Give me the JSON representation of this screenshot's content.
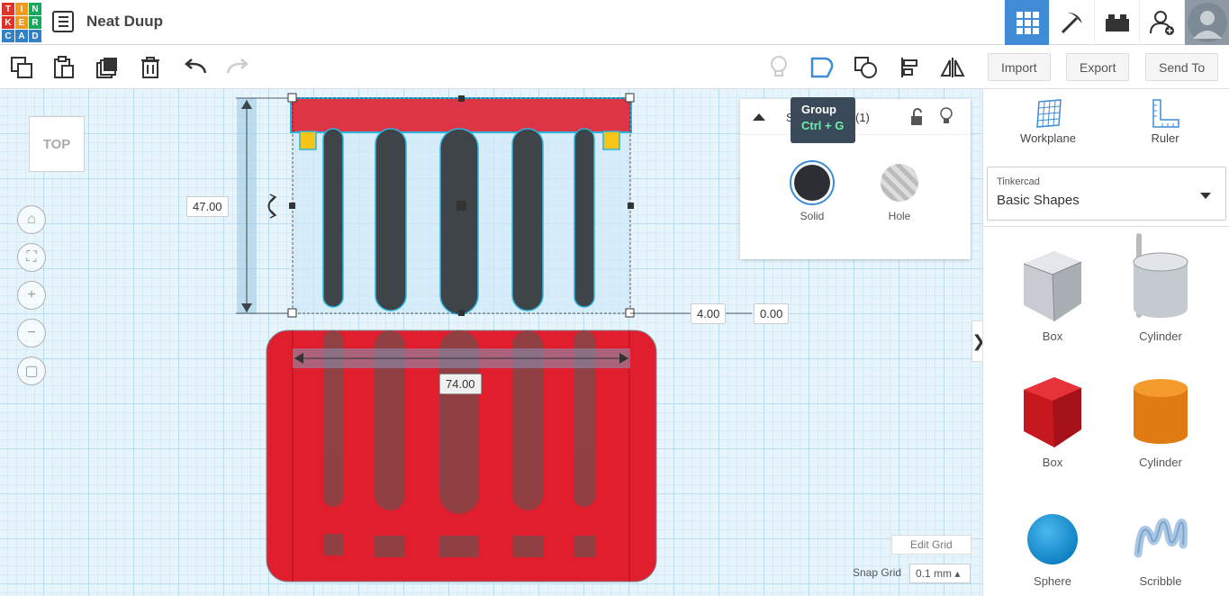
{
  "header": {
    "logo_letters": [
      "T",
      "I",
      "N",
      "K",
      "E",
      "R",
      "C",
      "A",
      "D"
    ],
    "logo_colors": [
      "#e2332a",
      "#f29a1f",
      "#16a85c",
      "#e2332a",
      "#f29a1f",
      "#16a85c",
      "#3381c4",
      "#3381c4",
      "#3381c4"
    ],
    "project_title": "Neat Duup"
  },
  "toolbar": {
    "import_label": "Import",
    "export_label": "Export",
    "sendto_label": "Send To"
  },
  "tooltip": {
    "title": "Group",
    "shortcut": "Ctrl + G"
  },
  "inspector": {
    "header_partial": "Sh",
    "header_partial_end": "(1)",
    "solid_label": "Solid",
    "hole_label": "Hole"
  },
  "viewcube": {
    "label": "TOP"
  },
  "dimensions": {
    "height": "47.00",
    "width": "74.00",
    "offset_x": "4.00",
    "offset_y": "0.00"
  },
  "rightpanel": {
    "workplane_label": "Workplane",
    "ruler_label": "Ruler",
    "library_source": "Tinkercad",
    "library_name": "Basic Shapes",
    "shapes": [
      {
        "label": "Box"
      },
      {
        "label": "Cylinder"
      },
      {
        "label": "Box"
      },
      {
        "label": "Cylinder"
      },
      {
        "label": "Sphere"
      },
      {
        "label": "Scribble"
      }
    ]
  },
  "grid": {
    "edit_grid_label": "Edit Grid",
    "snap_grid_label": "Snap Grid",
    "snap_value": "0.1 mm"
  },
  "colors": {
    "accent": "#3f8bd5",
    "red": "#dc3545",
    "dark": "#3f4448",
    "yellow": "#f5c518"
  }
}
